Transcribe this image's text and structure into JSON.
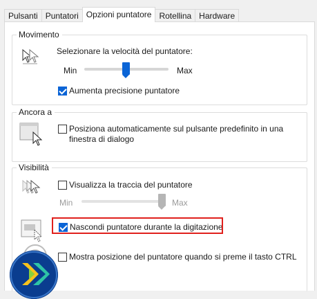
{
  "tabs": [
    {
      "label": "Pulsanti"
    },
    {
      "label": "Puntatori"
    },
    {
      "label": "Opzioni puntatore"
    },
    {
      "label": "Rotellina"
    },
    {
      "label": "Hardware"
    }
  ],
  "active_tab": "Opzioni puntatore",
  "movimento": {
    "title": "Movimento",
    "speed_label": "Selezionare la velocità del puntatore:",
    "min_label": "Min",
    "max_label": "Max",
    "speed_level": 0.6,
    "precision_label": "Aumenta precisione puntatore",
    "precision_checked": true
  },
  "ancora": {
    "title": "Ancora a",
    "snap_label": "Posiziona automaticamente sul pulsante predefinito in una finestra di dialogo",
    "snap_checked": false
  },
  "visibilita": {
    "title": "Visibilità",
    "trails_label": "Visualizza la traccia del puntatore",
    "trails_checked": false,
    "trails_min_label": "Min",
    "trails_max_label": "Max",
    "trails_level": 1.0,
    "hide_label": "Nascondi puntatore durante la digitazione",
    "hide_checked": true,
    "ctrl_label": "Mostra posizione del puntatore quando si preme il tasto CTRL",
    "ctrl_checked": false
  },
  "colors": {
    "accent": "#0a64d6",
    "highlight": "#e0201c"
  },
  "icons": [
    "pointer-speed-icon",
    "snap-to-icon",
    "pointer-trails-icon",
    "hide-pointer-icon",
    "show-location-icon",
    "logo-icon"
  ]
}
